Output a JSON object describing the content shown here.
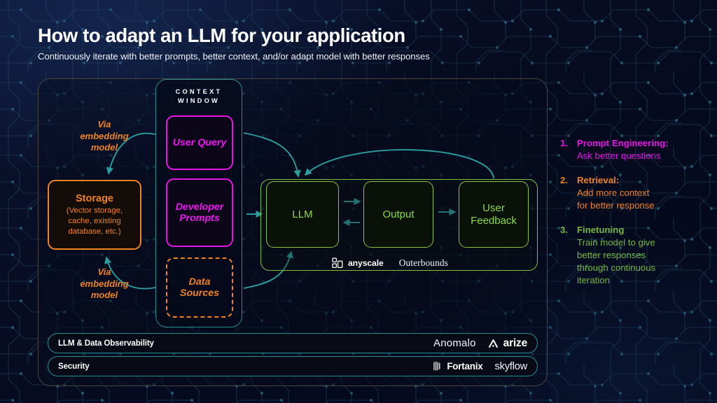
{
  "header": {
    "title": "How to adapt an LLM for your application",
    "subtitle": "Continuously iterate with better prompts, better context, and/or adapt model with better responses"
  },
  "context_window": {
    "title": "CONTEXT\nWINDOW",
    "title_line1": "CONTEXT",
    "title_line2": "WINDOW",
    "boxes": [
      {
        "label": "User Query",
        "color": "#f312f3",
        "style": "solid"
      },
      {
        "label": "Developer\nPrompts",
        "color": "#f312f3",
        "style": "solid"
      },
      {
        "label": "Data\nSources",
        "color": "#f08322",
        "style": "dashed"
      }
    ]
  },
  "storage": {
    "title": "Storage",
    "detail": "(Vector storage,\ncache, existing\ndatabase, etc.)",
    "color": "#f08322"
  },
  "annotations": {
    "via_embedding_top": "Via\nembedding\nmodel",
    "via_embedding_bottom": "Via\nembedding\nmodel"
  },
  "pipeline": {
    "boxes": [
      {
        "label": "LLM"
      },
      {
        "label": "Output"
      },
      {
        "label": "User\nFeedback"
      }
    ],
    "color": "#8bd944",
    "vendors": [
      {
        "name": "anyscale",
        "icon": "anyscale-blocks-icon"
      },
      {
        "name": "Outerbounds",
        "icon": "none"
      }
    ]
  },
  "bottom_bars": [
    {
      "label": "LLM & Data Observability",
      "logos": [
        {
          "name": "Anomalo",
          "icon": "none"
        },
        {
          "name": "arize",
          "icon": "arize-chevron-icon"
        }
      ]
    },
    {
      "label": "Security",
      "logos": [
        {
          "name": "Fortanix",
          "icon": "fortanix-mark-icon"
        },
        {
          "name": "skyflow",
          "icon": "none"
        }
      ]
    }
  ],
  "steps": [
    {
      "num": "1.",
      "title": "Prompt Engineering:",
      "desc": "Ask better questions",
      "color": "#e912e9"
    },
    {
      "num": "2.",
      "title": "Retrieval:",
      "desc": "Add more context\nfor better response",
      "color": "#f08322"
    },
    {
      "num": "3.",
      "title": "Finetuning",
      "desc": "Train model to give\nbetter responses\nthrough continuous\niteration",
      "color": "#74ba3c"
    }
  ],
  "theme": {
    "background": "#060a1c",
    "teal": "#1f8f92",
    "arrow_teal": "#2a9d9f",
    "magenta": "#e612e6",
    "orange": "#f08322",
    "green": "#8bc53f",
    "frame_border": "#4b4640"
  }
}
